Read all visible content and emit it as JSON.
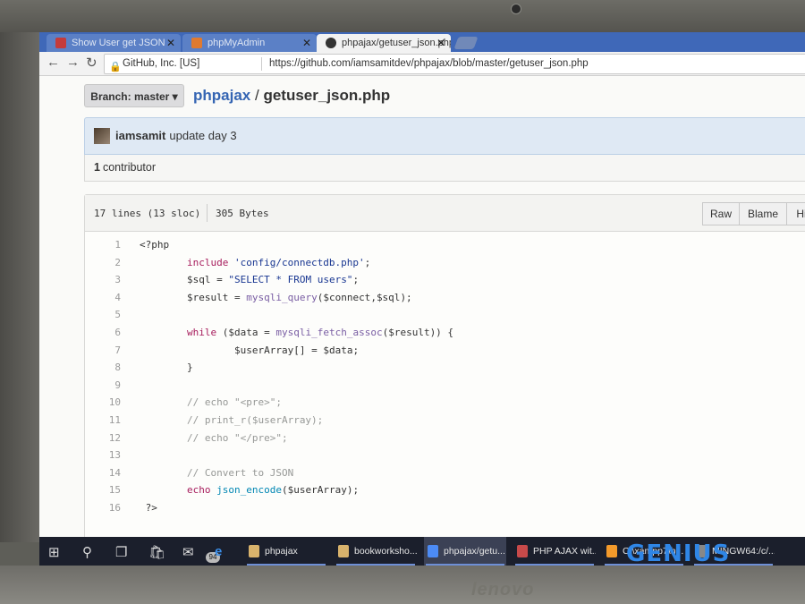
{
  "tabs": [
    {
      "label": "Show User get JSON",
      "color": "#c43b3b"
    },
    {
      "label": "phpMyAdmin",
      "color": "#e07a2f"
    },
    {
      "label": "phpajax/getuser_json.php",
      "color": "#333333"
    }
  ],
  "address": {
    "org": "GitHub, Inc. [US]",
    "url": "https://github.com/iamsamitdev/phpajax/blob/master/getuser_json.php"
  },
  "repo": {
    "branch_label": "Branch: master",
    "name": "phpajax",
    "separator": "/",
    "file": "getuser_json.php"
  },
  "commit": {
    "author": "iamsamit",
    "message": "update day 3"
  },
  "contributors": {
    "count": "1",
    "label": "contributor"
  },
  "file_info": {
    "lines": "17 lines (13 sloc)",
    "size": "305 Bytes"
  },
  "buttons": {
    "raw": "Raw",
    "blame": "Blame",
    "history": "His"
  },
  "code": [
    {
      "n": "1",
      "t": "<?php"
    },
    {
      "n": "2",
      "t": "        include 'config/connectdb.php';"
    },
    {
      "n": "3",
      "t": "        $sql = \"SELECT * FROM users\";"
    },
    {
      "n": "4",
      "t": "        $result = mysqli_query($connect,$sql);"
    },
    {
      "n": "5",
      "t": ""
    },
    {
      "n": "6",
      "t": "        while ($data = mysqli_fetch_assoc($result)) {"
    },
    {
      "n": "7",
      "t": "                $userArray[] = $data;"
    },
    {
      "n": "8",
      "t": "        }"
    },
    {
      "n": "9",
      "t": ""
    },
    {
      "n": "10",
      "t": "        // echo \"<pre>\";"
    },
    {
      "n": "11",
      "t": "        // print_r($userArray);"
    },
    {
      "n": "12",
      "t": "        // echo \"</pre>\";"
    },
    {
      "n": "13",
      "t": ""
    },
    {
      "n": "14",
      "t": "        // Convert to JSON"
    },
    {
      "n": "15",
      "t": "        echo json_encode($userArray);"
    },
    {
      "n": "16",
      "t": " ?>"
    }
  ],
  "taskbar": {
    "mail_badge": "94",
    "tasks": [
      {
        "label": "phpajax",
        "color": "#d9b36c"
      },
      {
        "label": "bookworksho...",
        "color": "#d9b36c"
      },
      {
        "label": "phpajax/getu...",
        "color": "#4c8bf5"
      },
      {
        "label": "PHP AJAX wit...",
        "color": "#c84a4a"
      },
      {
        "label": "C:\\xampp7\\h...",
        "color": "#f39a2b"
      },
      {
        "label": "MINGW64:/c/...",
        "color": "#888888"
      }
    ]
  },
  "watermark": "GENIUS",
  "laptop_brand": "lenovo"
}
